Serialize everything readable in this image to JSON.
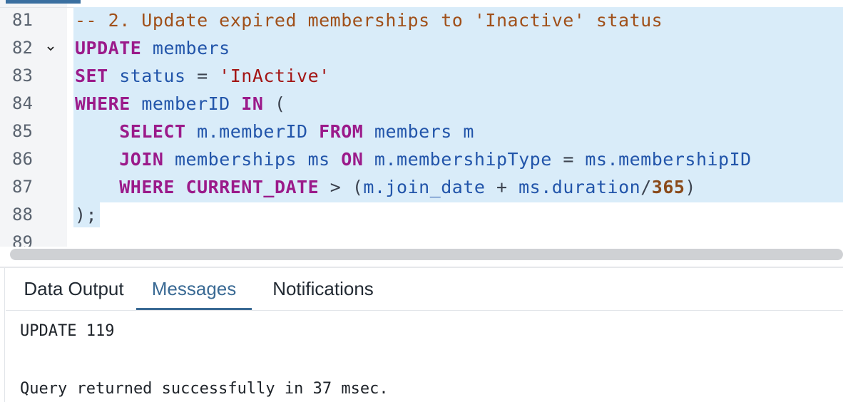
{
  "editor": {
    "lines": [
      {
        "no": "81",
        "foldable": false
      },
      {
        "no": "82",
        "foldable": true
      },
      {
        "no": "83",
        "foldable": false
      },
      {
        "no": "84",
        "foldable": false
      },
      {
        "no": "85",
        "foldable": false
      },
      {
        "no": "86",
        "foldable": false
      },
      {
        "no": "87",
        "foldable": false
      },
      {
        "no": "88",
        "foldable": false
      },
      {
        "no": "89",
        "foldable": false
      }
    ],
    "code": {
      "l81": "-- 2. Update expired memberships to 'Inactive' status",
      "l82_kw": "UPDATE",
      "l82_id": " members",
      "l83_kw": "SET",
      "l83_id": " status",
      "l83_op": " = ",
      "l83_str": "'InActive'",
      "l84_kw1": "WHERE",
      "l84_id": " memberID ",
      "l84_kw2": "IN",
      "l84_op": " (",
      "l85_indent": "    ",
      "l85_kw1": "SELECT",
      "l85_id1": " m.memberID ",
      "l85_kw2": "FROM",
      "l85_id2": " members m",
      "l86_indent": "    ",
      "l86_kw1": "JOIN",
      "l86_id1": " memberships ms ",
      "l86_kw2": "ON",
      "l86_id2": " m.membershipType ",
      "l86_op": "=",
      "l86_id3": " ms.membershipID",
      "l87_indent": "    ",
      "l87_kw1": "WHERE",
      "l87_sp": " ",
      "l87_kw2": "CURRENT_DATE",
      "l87_op1": " > (",
      "l87_id1": "m.join_date ",
      "l87_op2": "+",
      "l87_id2": " ms.duration",
      "l87_op3": "/",
      "l87_num": "365",
      "l87_op4": ")",
      "l88": ");"
    }
  },
  "tabs": [
    {
      "label": "Data Output",
      "active": false
    },
    {
      "label": "Messages",
      "active": true
    },
    {
      "label": "Notifications",
      "active": false
    }
  ],
  "messages": {
    "result": "UPDATE 119",
    "status": "Query returned successfully in 37 msec."
  },
  "colors": {
    "selection": "#d9ecf9",
    "keyword": "#9b1a8a",
    "string": "#a31515",
    "comment": "#a0501a",
    "active_tab": "#3a6a94"
  }
}
